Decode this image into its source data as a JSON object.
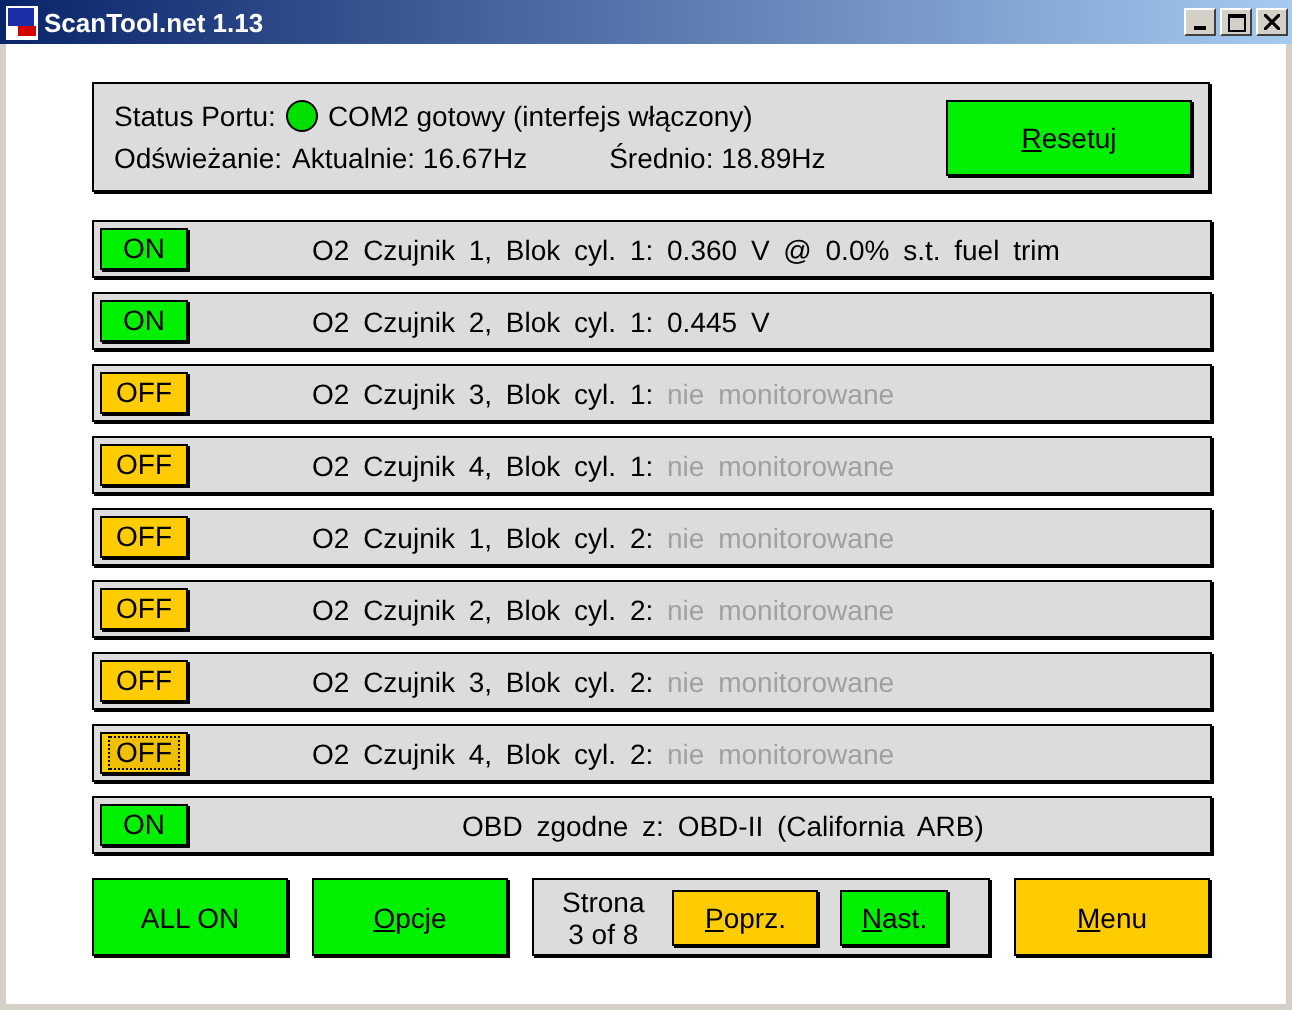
{
  "window": {
    "title": "ScanTool.net 1.13"
  },
  "status_panel": {
    "port_label": "Status Portu:",
    "port_ok": true,
    "port_text": "COM2 gotowy (interfejs włączony)",
    "refresh_label": "Odświeżanie:",
    "current": "Aktualnie: 16.67Hz",
    "average": "Średnio: 18.89Hz",
    "reset_button": {
      "label": "Resetuj",
      "mnemonic": true
    }
  },
  "rows": [
    {
      "kind": "sensor",
      "toggle": "ON",
      "on": true,
      "focused": false,
      "label": "O2 Czujnik 1, Blok cyl. 1:",
      "value": "0.360 V @ 0.0% s.t. fuel trim",
      "monitored": true
    },
    {
      "kind": "sensor",
      "toggle": "ON",
      "on": true,
      "focused": false,
      "label": "O2 Czujnik 2, Blok cyl. 1:",
      "value": "0.445 V",
      "monitored": true
    },
    {
      "kind": "sensor",
      "toggle": "OFF",
      "on": false,
      "focused": false,
      "label": "O2 Czujnik 3, Blok cyl. 1:",
      "value": "nie monitorowane",
      "monitored": false
    },
    {
      "kind": "sensor",
      "toggle": "OFF",
      "on": false,
      "focused": false,
      "label": "O2 Czujnik 4, Blok cyl. 1:",
      "value": "nie monitorowane",
      "monitored": false
    },
    {
      "kind": "sensor",
      "toggle": "OFF",
      "on": false,
      "focused": false,
      "label": "O2 Czujnik 1, Blok cyl. 2:",
      "value": "nie monitorowane",
      "monitored": false
    },
    {
      "kind": "sensor",
      "toggle": "OFF",
      "on": false,
      "focused": false,
      "label": "O2 Czujnik 2, Blok cyl. 2:",
      "value": "nie monitorowane",
      "monitored": false
    },
    {
      "kind": "sensor",
      "toggle": "OFF",
      "on": false,
      "focused": false,
      "label": "O2 Czujnik 3, Blok cyl. 2:",
      "value": "nie monitorowane",
      "monitored": false
    },
    {
      "kind": "sensor",
      "toggle": "OFF",
      "on": false,
      "focused": true,
      "label": "O2 Czujnik 4, Blok cyl. 2:",
      "value": "nie monitorowane",
      "monitored": false
    },
    {
      "kind": "summary",
      "toggle": "ON",
      "on": true,
      "focused": false,
      "label": "OBD zgodne z:",
      "value": "OBD-II (California ARB)",
      "monitored": true
    }
  ],
  "footer": {
    "all_on": {
      "label": "ALL ON",
      "mnemonic": false
    },
    "options": {
      "label": "Opcje",
      "mnemonic": true
    },
    "page_label": "Strona",
    "page_count": "3 of 8",
    "prev": {
      "label": "Poprz.",
      "mnemonic": true
    },
    "next": {
      "label": "Nast.",
      "mnemonic": true
    },
    "menu": {
      "label": "Menu",
      "mnemonic": true
    }
  }
}
